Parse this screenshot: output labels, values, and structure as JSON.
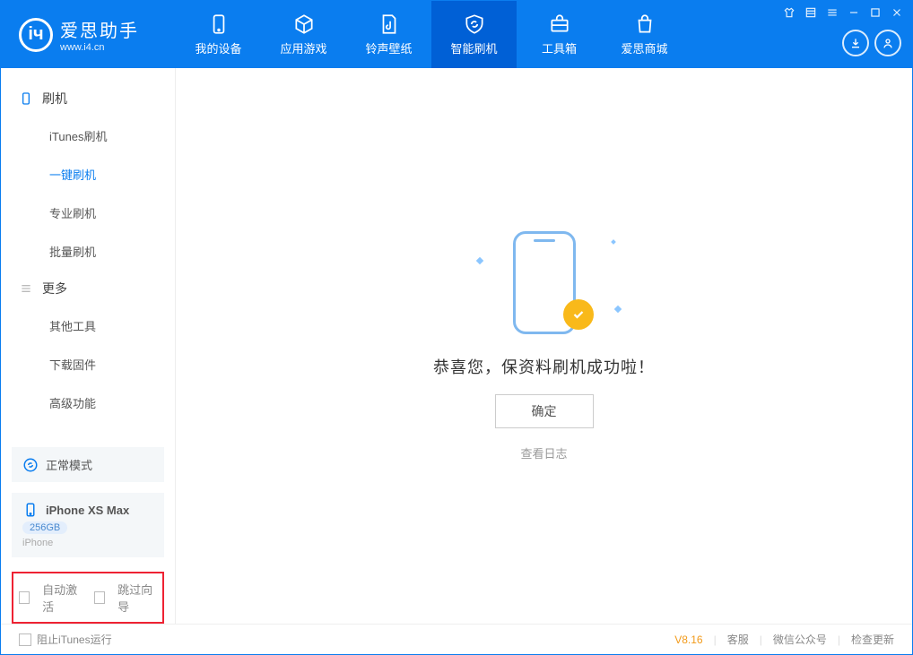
{
  "logo": {
    "title": "爱思助手",
    "subtitle": "www.i4.cn"
  },
  "nav": [
    {
      "label": "我的设备"
    },
    {
      "label": "应用游戏"
    },
    {
      "label": "铃声壁纸"
    },
    {
      "label": "智能刷机"
    },
    {
      "label": "工具箱"
    },
    {
      "label": "爱思商城"
    }
  ],
  "sidebar": {
    "section1": "刷机",
    "items1": [
      "iTunes刷机",
      "一键刷机",
      "专业刷机",
      "批量刷机"
    ],
    "section2": "更多",
    "items2": [
      "其他工具",
      "下载固件",
      "高级功能"
    ]
  },
  "mode": {
    "label": "正常模式"
  },
  "device": {
    "name": "iPhone XS Max",
    "capacity": "256GB",
    "type": "iPhone"
  },
  "options": {
    "auto_activate": "自动激活",
    "skip_guide": "跳过向导"
  },
  "result": {
    "message": "恭喜您，保资料刷机成功啦！",
    "ok": "确定",
    "view_log": "查看日志"
  },
  "footer": {
    "block_itunes": "阻止iTunes运行",
    "version": "V8.16",
    "links": [
      "客服",
      "微信公众号",
      "检查更新"
    ]
  }
}
